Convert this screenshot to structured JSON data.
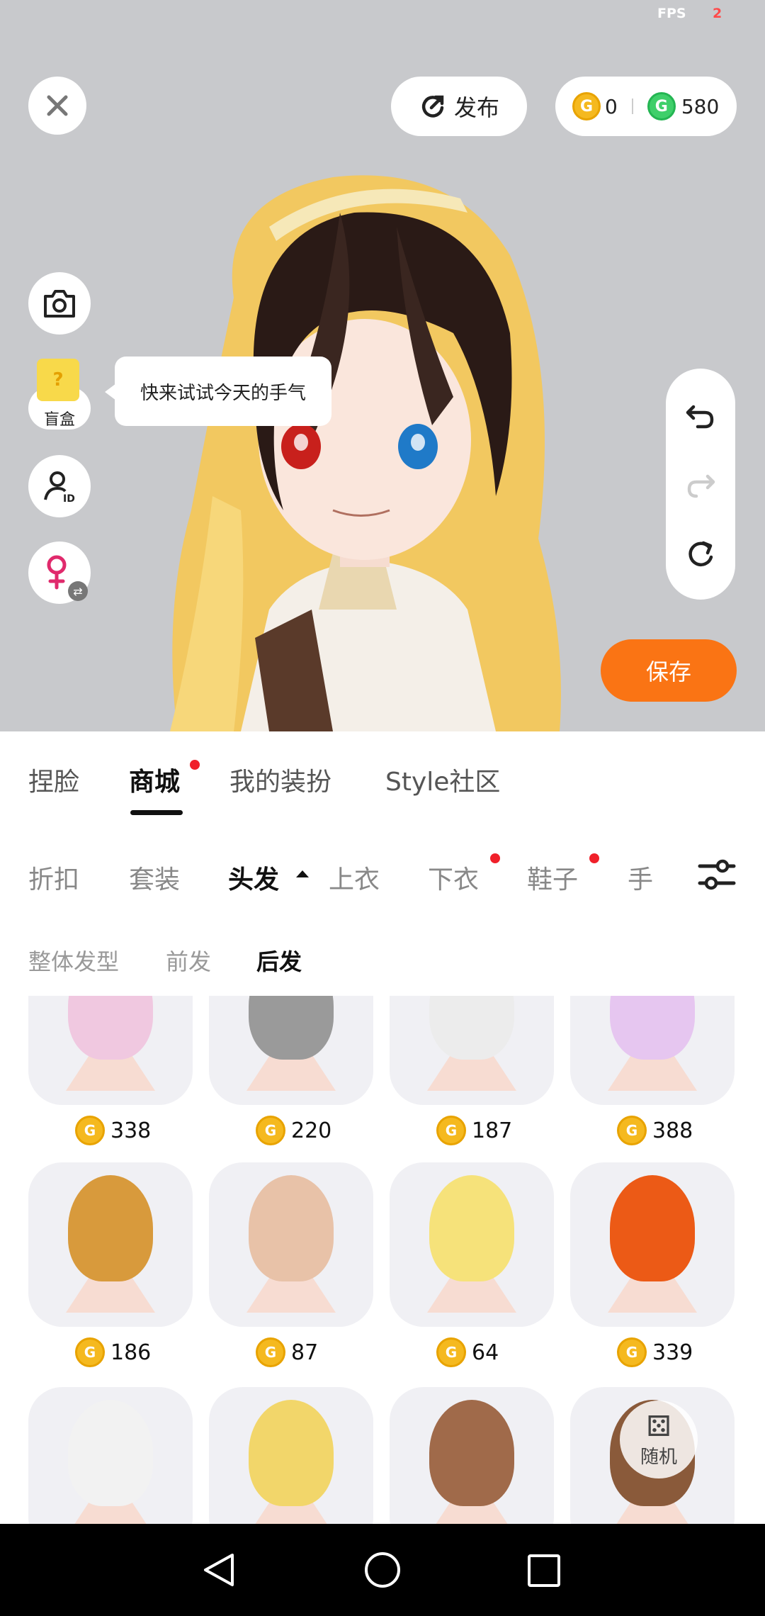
{
  "status": {
    "fps_label": "FPS",
    "fps_value": "2"
  },
  "header": {
    "publish_label": "发布",
    "gold_balance": "0",
    "green_balance": "580"
  },
  "tooltip": {
    "text": "快来试试今天的手气"
  },
  "blindbox": {
    "label": "盲盒"
  },
  "save_label": "保存",
  "main_tabs": [
    {
      "label": "捏脸"
    },
    {
      "label": "商城"
    },
    {
      "label": "我的装扮"
    },
    {
      "label": "Style社区"
    }
  ],
  "categories": [
    {
      "label": "折扣"
    },
    {
      "label": "套装"
    },
    {
      "label": "头发"
    },
    {
      "label": "上衣"
    },
    {
      "label": "下衣"
    },
    {
      "label": "鞋子"
    },
    {
      "label": "手套"
    }
  ],
  "subcategories": [
    {
      "label": "整体发型"
    },
    {
      "label": "前发"
    },
    {
      "label": "后发"
    }
  ],
  "items": [
    {
      "price": "338",
      "color": "#f0c8e0"
    },
    {
      "price": "220",
      "color": "#9a9a9a"
    },
    {
      "price": "187",
      "color": "#ececec"
    },
    {
      "price": "388",
      "color": "#e6c6f0"
    },
    {
      "price": "186",
      "color": "#d89a3c"
    },
    {
      "price": "87",
      "color": "#e8c2a8"
    },
    {
      "price": "64",
      "color": "#f6e27a"
    },
    {
      "price": "339",
      "color": "#ec5a16"
    },
    {
      "price": "",
      "color": "#f2f2f2"
    },
    {
      "price": "",
      "color": "#f2d66a"
    },
    {
      "price": "",
      "color": "#a06a4a"
    },
    {
      "price": "",
      "color": "#8a5a3a"
    }
  ],
  "random_label": "随机",
  "colors": {
    "accent": "#fa7414",
    "coin_gold": "#f5b91f",
    "coin_green": "#3fcf6a",
    "badge": "#f0202a"
  }
}
